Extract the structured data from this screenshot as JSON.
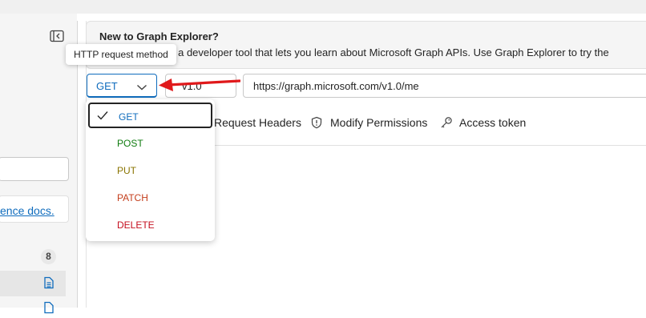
{
  "banner": {
    "title": "New to Graph Explorer?",
    "text": "s a developer tool that lets you learn about Microsoft Graph APIs. Use Graph Explorer to try the"
  },
  "tooltip": {
    "text": "HTTP request method"
  },
  "query": {
    "method": "GET",
    "version": "v1.0",
    "url": "https://graph.microsoft.com/v1.0/me"
  },
  "tabs": [
    {
      "label": "Request Headers",
      "icon": "request-headers-icon"
    },
    {
      "label": "Modify Permissions",
      "icon": "shield-icon"
    },
    {
      "label": "Access token",
      "icon": "key-icon"
    }
  ],
  "methods": [
    {
      "label": "GET",
      "color": "#0f6cbd",
      "selected": true
    },
    {
      "label": "POST",
      "color": "#107c10",
      "selected": false
    },
    {
      "label": "PUT",
      "color": "#8a7400",
      "selected": false
    },
    {
      "label": "PATCH",
      "color": "#c43e1c",
      "selected": false
    },
    {
      "label": "DELETE",
      "color": "#c50f1f",
      "selected": false
    }
  ],
  "sidebar": {
    "reference_link": "ence docs.",
    "count": "8"
  },
  "colors": {
    "accent": "#0f6cbd",
    "annotation_arrow": "#e0191b"
  }
}
